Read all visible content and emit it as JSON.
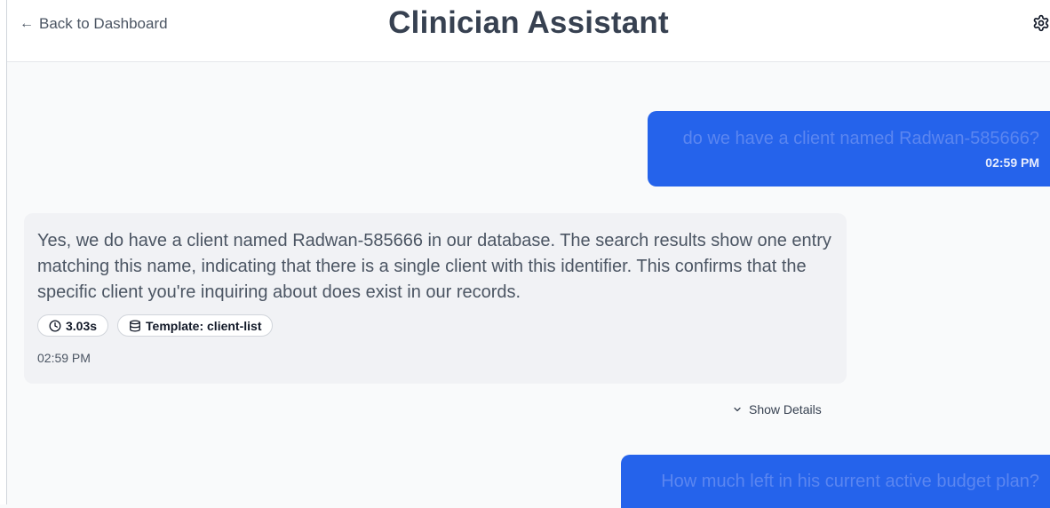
{
  "header": {
    "back_label": "Back to Dashboard",
    "back_icon": "arrow-left-icon",
    "title": "Clinician Assistant",
    "settings_icon": "gear-icon"
  },
  "messages": [
    {
      "role": "user",
      "text": "do we have a client named Radwan-585666?",
      "time": "02:59 PM"
    },
    {
      "role": "assistant",
      "text": "Yes, we do have a client named Radwan-585666 in our database. The search results show one entry matching this name, indicating that there is a single client with this identifier. This confirms that the specific client you're inquiring about does exist in our records.",
      "badges": [
        {
          "icon": "clock-icon",
          "label": "3.03s"
        },
        {
          "icon": "database-icon",
          "label": "Template: client-list"
        }
      ],
      "time": "02:59 PM",
      "details_toggle": "Show Details"
    },
    {
      "role": "user",
      "text": "How much left in his current active budget plan?"
    }
  ],
  "colors": {
    "user_bubble": "#2563eb",
    "assistant_bubble": "#f1f2f5",
    "background": "#f9fafb"
  }
}
